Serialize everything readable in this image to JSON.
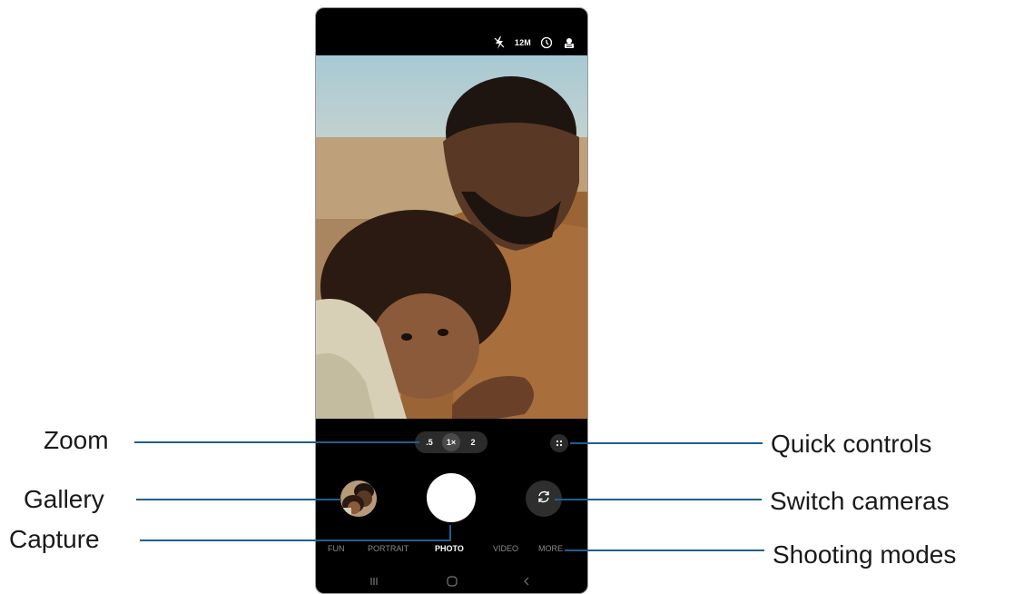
{
  "status_bar": {
    "flash_icon": "flash-off-icon",
    "resolution": "12M",
    "timer_icon": "timer-icon",
    "settings_icon": "settings-icon"
  },
  "zoom": {
    "options": [
      ".5",
      "1×",
      "2"
    ],
    "active_index": 1
  },
  "quick_controls_icon": "dots-icon",
  "shooting_modes": [
    "FUN",
    "PORTRAIT",
    "PHOTO",
    "VIDEO",
    "MORE"
  ],
  "active_mode": "PHOTO",
  "nav_icons": [
    "recents-icon",
    "home-icon",
    "back-icon"
  ],
  "callouts": {
    "zoom": "Zoom",
    "gallery": "Gallery",
    "capture": "Capture",
    "quick_controls": "Quick controls",
    "switch_cameras": "Switch cameras",
    "shooting_modes": "Shooting modes"
  },
  "colors": {
    "callout_line": "#1f5f8f",
    "phone_bg": "#000000"
  }
}
